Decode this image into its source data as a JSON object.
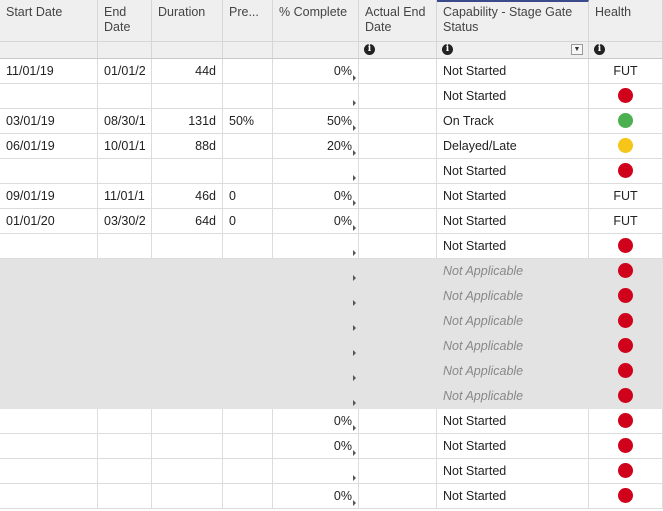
{
  "columns": {
    "start_date": "Start Date",
    "end_date": "End Date",
    "duration": "Duration",
    "pred": "Pre...",
    "pct_complete": "% Complete",
    "actual_end": "Actual End Date",
    "status": "Capability - Stage Gate Status",
    "health": "Health"
  },
  "colors": {
    "red": "#d0021b",
    "green": "#4caf50",
    "yellow": "#f5c518"
  },
  "rows": [
    {
      "start": "11/01/19",
      "end": "01/01/2",
      "duration": "44d",
      "pred": "",
      "pct": "0%",
      "status": "Not Started",
      "health": "FUT",
      "grey": false
    },
    {
      "start": "",
      "end": "",
      "duration": "",
      "pred": "",
      "pct": "",
      "status": "Not Started",
      "health": "red",
      "grey": false
    },
    {
      "start": "03/01/19",
      "end": "08/30/1",
      "duration": "131d",
      "pred": "50%",
      "pct": "50%",
      "status": "On Track",
      "health": "green",
      "grey": false
    },
    {
      "start": "06/01/19",
      "end": "10/01/1",
      "duration": "88d",
      "pred": "",
      "pct": "20%",
      "status": "Delayed/Late",
      "health": "yellow",
      "grey": false
    },
    {
      "start": "",
      "end": "",
      "duration": "",
      "pred": "",
      "pct": "",
      "status": "Not Started",
      "health": "red",
      "grey": false
    },
    {
      "start": "09/01/19",
      "end": "11/01/1",
      "duration": "46d",
      "pred": "0",
      "pct": "0%",
      "status": "Not Started",
      "health": "FUT",
      "grey": false
    },
    {
      "start": "01/01/20",
      "end": "03/30/2",
      "duration": "64d",
      "pred": "0",
      "pct": "0%",
      "status": "Not Started",
      "health": "FUT",
      "grey": false
    },
    {
      "start": "",
      "end": "",
      "duration": "",
      "pred": "",
      "pct": "",
      "status": "Not Started",
      "health": "red",
      "grey": false
    },
    {
      "start": "",
      "end": "",
      "duration": "",
      "pred": "",
      "pct": "",
      "status": "Not Applicable",
      "health": "red",
      "grey": true
    },
    {
      "start": "",
      "end": "",
      "duration": "",
      "pred": "",
      "pct": "",
      "status": "Not Applicable",
      "health": "red",
      "grey": true
    },
    {
      "start": "",
      "end": "",
      "duration": "",
      "pred": "",
      "pct": "",
      "status": "Not Applicable",
      "health": "red",
      "grey": true
    },
    {
      "start": "",
      "end": "",
      "duration": "",
      "pred": "",
      "pct": "",
      "status": "Not Applicable",
      "health": "red",
      "grey": true
    },
    {
      "start": "",
      "end": "",
      "duration": "",
      "pred": "",
      "pct": "",
      "status": "Not Applicable",
      "health": "red",
      "grey": true
    },
    {
      "start": "",
      "end": "",
      "duration": "",
      "pred": "",
      "pct": "",
      "status": "Not Applicable",
      "health": "red",
      "grey": true
    },
    {
      "start": "",
      "end": "",
      "duration": "",
      "pred": "",
      "pct": "0%",
      "status": "Not Started",
      "health": "red",
      "grey": false
    },
    {
      "start": "",
      "end": "",
      "duration": "",
      "pred": "",
      "pct": "0%",
      "status": "Not Started",
      "health": "red",
      "grey": false
    },
    {
      "start": "",
      "end": "",
      "duration": "",
      "pred": "",
      "pct": "",
      "status": "Not Started",
      "health": "red",
      "grey": false
    },
    {
      "start": "",
      "end": "",
      "duration": "",
      "pred": "",
      "pct": "0%",
      "status": "Not Started",
      "health": "red",
      "grey": false
    }
  ]
}
